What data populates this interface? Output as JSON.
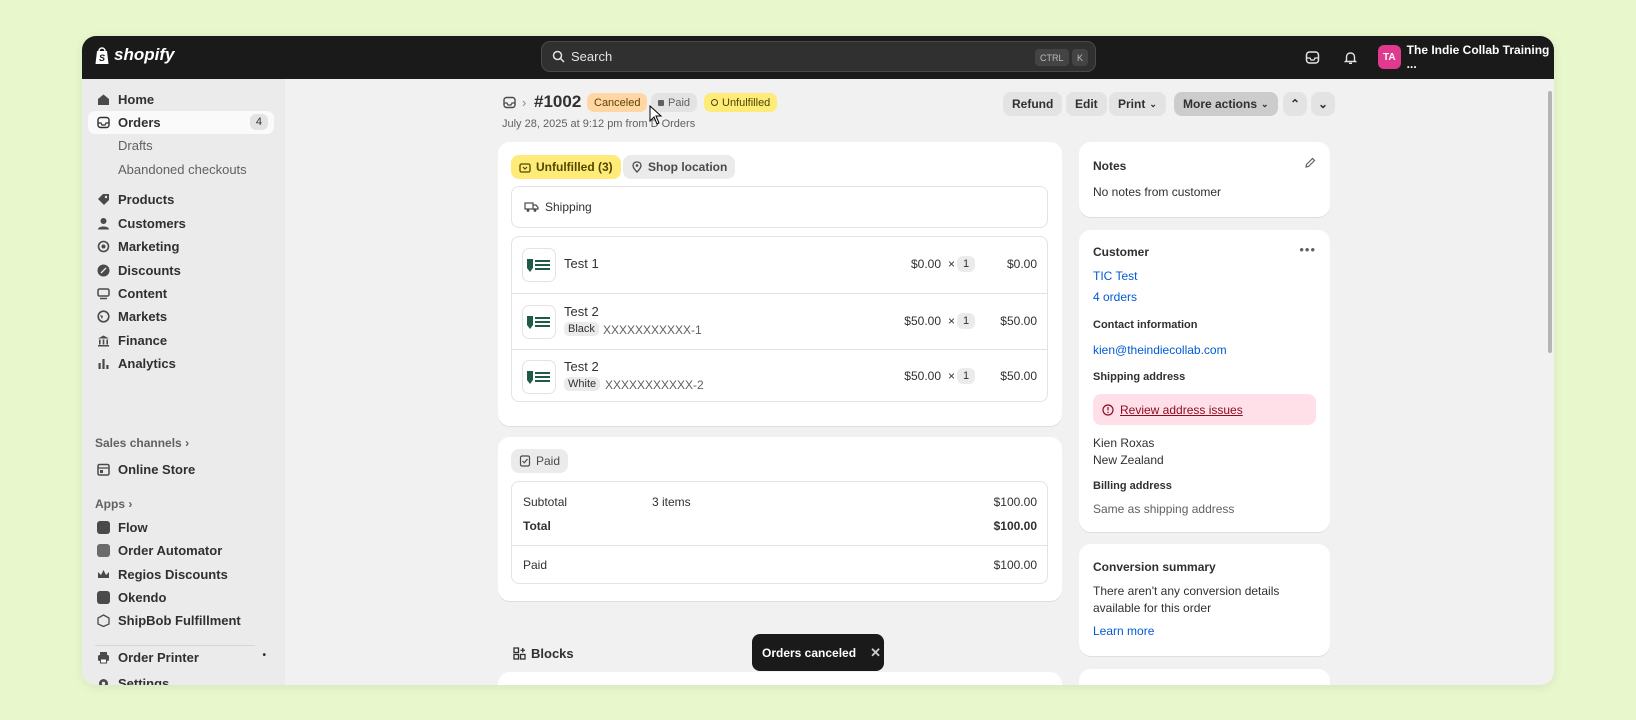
{
  "topbar": {
    "brand": "shopify",
    "search_placeholder": "Search",
    "kbd_ctrl": "CTRL",
    "kbd_k": "K",
    "store_initials": "TA",
    "store_name": "The Indie Collab Training ..."
  },
  "sidebar": {
    "home": "Home",
    "orders": "Orders",
    "orders_count": "4",
    "drafts": "Drafts",
    "abandoned": "Abandoned checkouts",
    "products": "Products",
    "customers": "Customers",
    "marketing": "Marketing",
    "discounts": "Discounts",
    "content": "Content",
    "markets": "Markets",
    "finance": "Finance",
    "analytics": "Analytics",
    "sales_channels": "Sales channels",
    "online_store": "Online Store",
    "apps": "Apps",
    "flow": "Flow",
    "order_automator": "Order Automator",
    "regios": "Regios Discounts",
    "okendo": "Okendo",
    "shipbob": "ShipBob Fulfillment",
    "order_printer": "Order Printer",
    "settings": "Settings"
  },
  "header": {
    "order_number": "#1002",
    "badge_canceled": "Canceled",
    "badge_paid": "Paid",
    "badge_unfulfilled": "Unfulfilled",
    "date_prefix": "July 28, 2025 at 9:12 pm from D",
    "date_suffix": " Orders",
    "refund": "Refund",
    "edit": "Edit",
    "print": "Print",
    "more_actions": "More actions"
  },
  "fulfillment": {
    "chip_unfulfilled": "Unfulfilled (3)",
    "chip_location": "Shop location",
    "shipping": "Shipping",
    "items": [
      {
        "name": "Test 1",
        "variant": "",
        "sku": "",
        "price": "$0.00",
        "qty": "1",
        "total": "$0.00"
      },
      {
        "name": "Test 2",
        "variant": "Black",
        "sku": "XXXXXXXXXXX-1",
        "price": "$50.00",
        "qty": "1",
        "total": "$50.00"
      },
      {
        "name": "Test 2",
        "variant": "White",
        "sku": "XXXXXXXXXXX-2",
        "price": "$50.00",
        "qty": "1",
        "total": "$50.00"
      }
    ],
    "times": "×"
  },
  "payment": {
    "chip_paid": "Paid",
    "subtotal_label": "Subtotal",
    "subtotal_items": "3 items",
    "subtotal_value": "$100.00",
    "total_label": "Total",
    "total_value": "$100.00",
    "paid_label": "Paid",
    "paid_value": "$100.00"
  },
  "blocks": {
    "label": "Blocks"
  },
  "notes": {
    "title": "Notes",
    "text": "No notes from customer"
  },
  "customer": {
    "title": "Customer",
    "name": "TIC Test",
    "orders": "4 orders",
    "contact_title": "Contact information",
    "email": "kien@theindiecollab.com",
    "shipping_title": "Shipping address",
    "review_issues": "Review address issues",
    "address_name": "Kien Roxas",
    "address_country": "New Zealand",
    "billing_title": "Billing address",
    "billing_text": "Same as shipping address"
  },
  "conversion": {
    "title": "Conversion summary",
    "text_line1": "There aren't any conversion details",
    "text_line2": "available for this order",
    "learn_more": "Learn more"
  },
  "toast": {
    "text": "Orders canceled"
  },
  "colors": {
    "badge_canceled_bg": "#ffd6a4",
    "badge_unfulfilled_bg": "#ffeb78",
    "review_bg": "#ffe0e9",
    "link": "#005bd3"
  }
}
